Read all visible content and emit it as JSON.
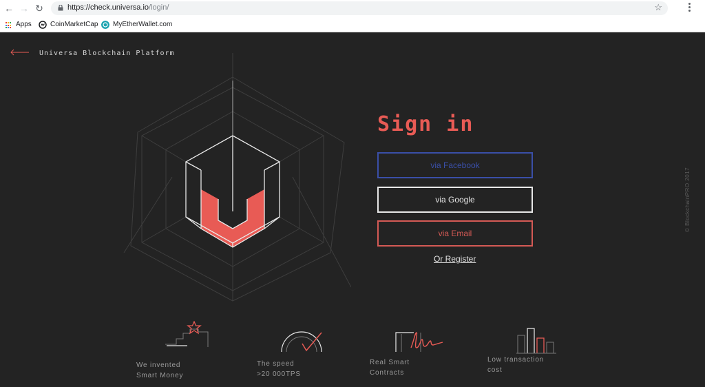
{
  "browser": {
    "url_host": "https://check.universa.io",
    "url_path": "/login/",
    "bookmarks": [
      {
        "label": "Apps",
        "icon": "apps-grid-icon"
      },
      {
        "label": "CoinMarketCap",
        "icon": "coinmarketcap-icon"
      },
      {
        "label": "MyEtherWallet.com",
        "icon": "myetherwallet-icon"
      }
    ]
  },
  "header": {
    "brand": "Universa Blockchain Platform",
    "back_icon": "arrow-left-icon"
  },
  "signin": {
    "title": "Sign in",
    "facebook": "via Facebook",
    "google": "via Google",
    "email": "via Email",
    "register": "Or Register"
  },
  "copyright": "© BlockchainPRO 2017",
  "features": [
    {
      "line1": "We invented",
      "line2": "Smart Money",
      "icon": "stairs-star-icon"
    },
    {
      "line1": "The speed",
      "line2": ">20 000TPS",
      "icon": "speedometer-icon"
    },
    {
      "line1": "Real Smart",
      "line2": "Contracts",
      "icon": "signature-icon"
    },
    {
      "line1": "Low transaction",
      "line2": "cost",
      "icon": "bar-graph-icon"
    }
  ],
  "colors": {
    "accent": "#e85b55",
    "facebook": "#3a4fa8",
    "background": "#232323"
  }
}
